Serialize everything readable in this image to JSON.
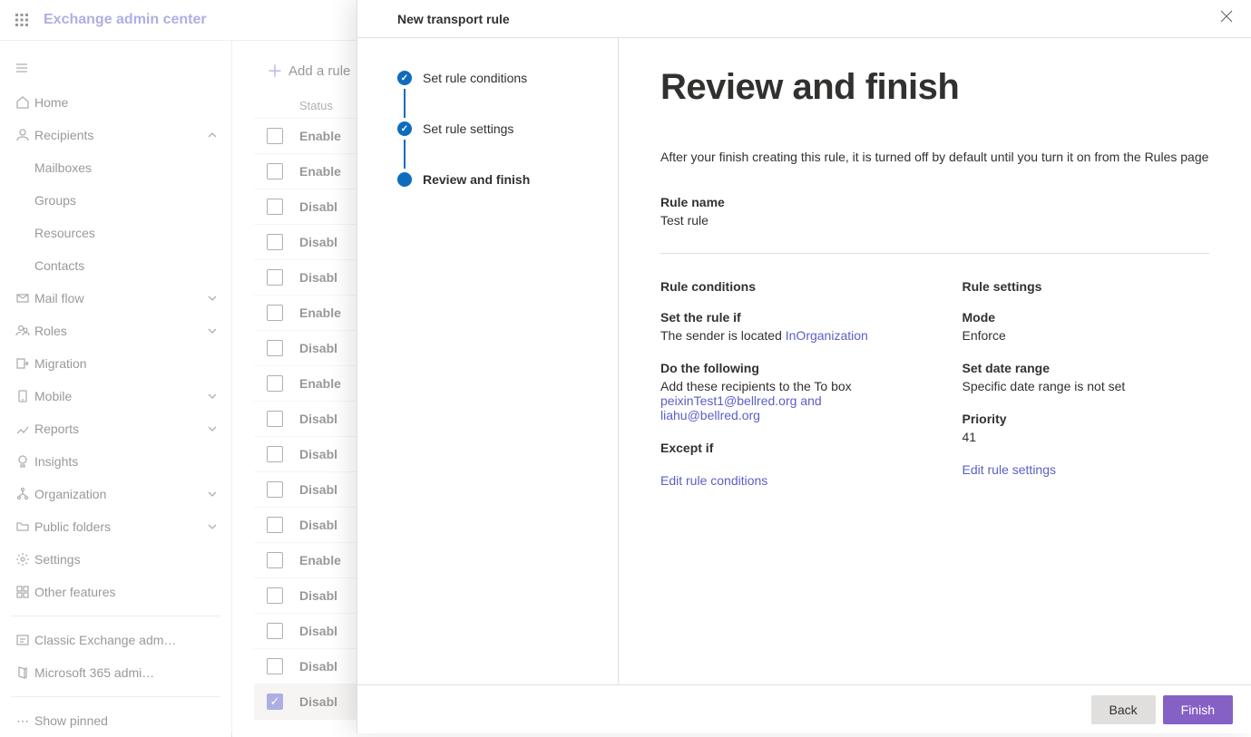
{
  "topbar": {
    "title": "Exchange admin center"
  },
  "sidebar": {
    "items": [
      {
        "id": "home",
        "label": "Home",
        "icon": "home-icon"
      },
      {
        "id": "recipients",
        "label": "Recipients",
        "icon": "person-icon",
        "expanded": true,
        "children": [
          {
            "id": "mailboxes",
            "label": "Mailboxes"
          },
          {
            "id": "groups",
            "label": "Groups"
          },
          {
            "id": "resources",
            "label": "Resources"
          },
          {
            "id": "contacts",
            "label": "Contacts"
          }
        ]
      },
      {
        "id": "mailflow",
        "label": "Mail flow",
        "icon": "mail-icon",
        "expandable": true
      },
      {
        "id": "roles",
        "label": "Roles",
        "icon": "roles-icon",
        "expandable": true
      },
      {
        "id": "migration",
        "label": "Migration",
        "icon": "migration-icon"
      },
      {
        "id": "mobile",
        "label": "Mobile",
        "icon": "mobile-icon",
        "expandable": true
      },
      {
        "id": "reports",
        "label": "Reports",
        "icon": "reports-icon",
        "expandable": true
      },
      {
        "id": "insights",
        "label": "Insights",
        "icon": "insights-icon"
      },
      {
        "id": "organization",
        "label": "Organization",
        "icon": "org-icon",
        "expandable": true
      },
      {
        "id": "publicfolders",
        "label": "Public folders",
        "icon": "folder-icon",
        "expandable": true
      },
      {
        "id": "settings",
        "label": "Settings",
        "icon": "gear-icon"
      },
      {
        "id": "otherfeatures",
        "label": "Other features",
        "icon": "grid-icon"
      }
    ],
    "footer_items": [
      {
        "id": "classic",
        "label": "Classic Exchange adm…",
        "icon": "classic-icon"
      },
      {
        "id": "m365",
        "label": "Microsoft 365 admi…",
        "icon": "m365-icon"
      }
    ],
    "show_pinned": "Show pinned"
  },
  "content": {
    "add_rule": "Add a rule",
    "column_status": "Status",
    "rows": [
      {
        "status": "Enable",
        "checked": false
      },
      {
        "status": "Enable",
        "checked": false
      },
      {
        "status": "Disabl",
        "checked": false
      },
      {
        "status": "Disabl",
        "checked": false
      },
      {
        "status": "Disabl",
        "checked": false
      },
      {
        "status": "Enable",
        "checked": false
      },
      {
        "status": "Disabl",
        "checked": false
      },
      {
        "status": "Enable",
        "checked": false
      },
      {
        "status": "Disabl",
        "checked": false
      },
      {
        "status": "Disabl",
        "checked": false
      },
      {
        "status": "Disabl",
        "checked": false
      },
      {
        "status": "Disabl",
        "checked": false
      },
      {
        "status": "Enable",
        "checked": false
      },
      {
        "status": "Disabl",
        "checked": false
      },
      {
        "status": "Disabl",
        "checked": false
      },
      {
        "status": "Disabl",
        "checked": false
      },
      {
        "status": "Disabl",
        "checked": true
      }
    ]
  },
  "panel": {
    "title": "New transport rule",
    "steps": [
      {
        "label": "Set rule conditions",
        "state": "done"
      },
      {
        "label": "Set rule settings",
        "state": "done"
      },
      {
        "label": "Review and finish",
        "state": "active"
      }
    ],
    "review": {
      "heading": "Review and finish",
      "intro": "After your finish creating this rule, it is turned off by default until you turn it on from the Rules page",
      "rule_name_label": "Rule name",
      "rule_name_value": "Test rule",
      "conditions": {
        "title": "Rule conditions",
        "set_if_label": "Set the rule if",
        "set_if_value_prefix": "The sender is located ",
        "set_if_link": "InOrganization",
        "do_label": "Do the following",
        "do_value": "Add these recipients to the To box",
        "do_link": "peixinTest1@bellred.org and liahu@bellred.org",
        "except_label": "Except if",
        "edit_link": "Edit rule conditions"
      },
      "settings": {
        "title": "Rule settings",
        "mode_label": "Mode",
        "mode_value": "Enforce",
        "date_label": "Set date range",
        "date_value": "Specific date range is not set",
        "priority_label": "Priority",
        "priority_value": "41",
        "edit_link": "Edit rule settings"
      }
    },
    "footer": {
      "back": "Back",
      "finish": "Finish"
    }
  }
}
